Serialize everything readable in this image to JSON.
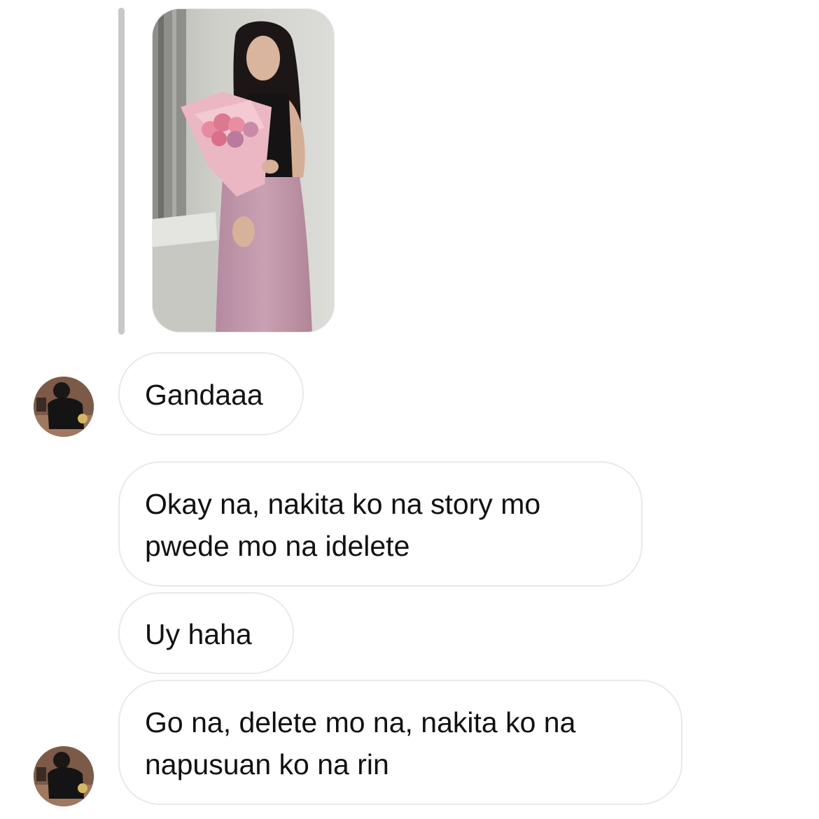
{
  "story_reply": {
    "image_alt": "Story photo: woman holding a pink flower bouquet"
  },
  "messages": [
    {
      "lines": [
        "Gandaaa"
      ],
      "has_avatar": true
    },
    {
      "lines": [
        "Okay na, nakita ko na story mo",
        "pwede mo na idelete"
      ],
      "has_avatar": false
    },
    {
      "lines": [
        "Uy haha"
      ],
      "has_avatar": false
    },
    {
      "lines": [
        "Go na, delete mo na, nakita ko na",
        "napusuan ko na rin"
      ],
      "has_avatar": true
    }
  ],
  "colors": {
    "bubble_border": "#e9e9e9",
    "reply_bar": "#c8c8c8",
    "text": "#111111",
    "background": "#ffffff"
  }
}
